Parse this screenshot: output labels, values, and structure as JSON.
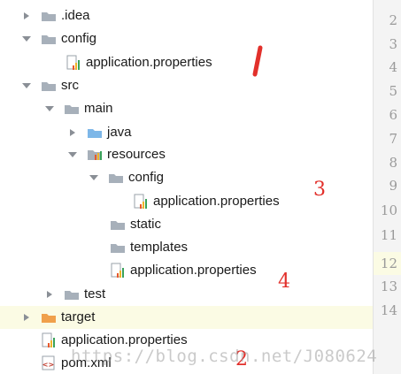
{
  "tree": {
    "nodes": [
      {
        "label": ".idea"
      },
      {
        "label": "config"
      },
      {
        "label": "application.properties"
      },
      {
        "label": "src"
      },
      {
        "label": "main"
      },
      {
        "label": "java"
      },
      {
        "label": "resources"
      },
      {
        "label": "config"
      },
      {
        "label": "application.properties"
      },
      {
        "label": "static"
      },
      {
        "label": "templates"
      },
      {
        "label": "application.properties"
      },
      {
        "label": "test"
      },
      {
        "label": "target"
      },
      {
        "label": "application.properties"
      },
      {
        "label": "pom.xml"
      }
    ]
  },
  "gutter": {
    "line_numbers": [
      "2",
      "3",
      "4",
      "5",
      "6",
      "7",
      "8",
      "9",
      "10",
      "11",
      "12",
      "13",
      "14"
    ],
    "current_line": "12"
  },
  "annotations": {
    "mark_3": "3",
    "mark_4": "4",
    "mark_2": "2"
  },
  "watermark": "https://blog.csdn.net/J080624",
  "colors": {
    "accent_top": "#3d78c9",
    "selection_band": "#fbfbe4",
    "annotation_red": "#e2302b",
    "folder_gray": "#a7b0ba",
    "folder_blue": "#7db7e8",
    "folder_orange": "#f0a04b"
  }
}
